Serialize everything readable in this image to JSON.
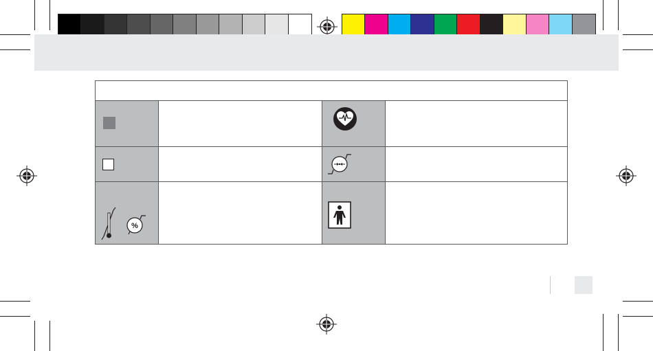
{
  "colors": {
    "grayscale": [
      "#000000",
      "#1a1a1a",
      "#333333",
      "#4d4d4d",
      "#666666",
      "#808080",
      "#999999",
      "#b3b3b3",
      "#cccccc",
      "#e6e6e6",
      "#ffffff"
    ],
    "process": [
      "#fff200",
      "#ec008c",
      "#00aeef",
      "#2e3192",
      "#00a651",
      "#ed1c24",
      "#231f20",
      "#fff799",
      "#f585c5",
      "#7dd8f8",
      "#939598"
    ],
    "header_band": "#e8e9ea",
    "table_border": "#58595b",
    "symbol_cell": "#bcbec0"
  },
  "symbols": {
    "filled_square": "filled-square-icon",
    "empty_square": "empty-square-icon",
    "heart_rhythm": "heart-rhythm-icon",
    "pressure_limit": "pressure-limit-icon",
    "temperature_limit": "temperature-limit-icon",
    "humidity_limit": "humidity-limit-icon",
    "humidity_glyph": "%",
    "bf_applied_part": "type-bf-applied-part-icon"
  }
}
